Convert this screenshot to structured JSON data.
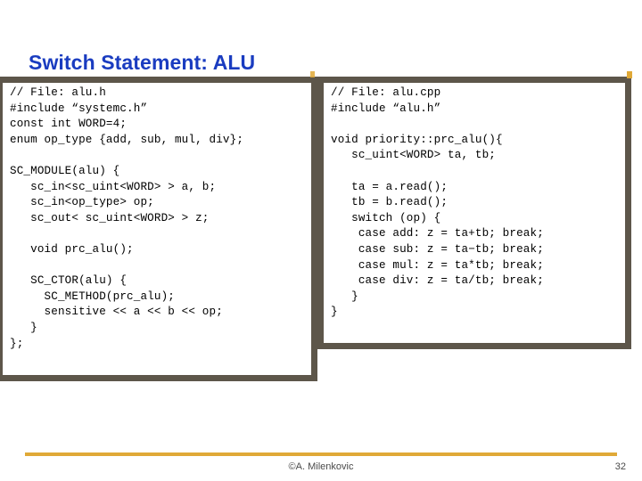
{
  "slide": {
    "title": "Switch Statement: ALU",
    "title_color": "#1a3cc0",
    "accent_color": "#e0a937",
    "box_border_color": "#5d564a"
  },
  "code_boxes": [
    {
      "name": "alu-header",
      "language": "cpp",
      "code": "// File: alu.h\n#include “systemc.h”\nconst int WORD=4;\nenum op_type {add, sub, mul, div};\n\nSC_MODULE(alu) {\n   sc_in<sc_uint<WORD> > a, b;\n   sc_in<op_type> op;\n   sc_out< sc_uint<WORD> > z;\n\n   void prc_alu();\n\n   SC_CTOR(alu) {\n     SC_METHOD(prc_alu);\n     sensitive << a << b << op;\n   }\n};"
    },
    {
      "name": "alu-implementation",
      "language": "cpp",
      "code": "// File: alu.cpp\n#include “alu.h”\n\nvoid priority::prc_alu(){\n   sc_uint<WORD> ta, tb;\n\n   ta = a.read();\n   tb = b.read();\n   switch (op) {\n    case add: z = ta+tb; break;\n    case sub: z = ta−tb; break;\n    case mul: z = ta*tb; break;\n    case div: z = ta/tb; break;\n   }\n}"
    }
  ],
  "footer": {
    "author": "©A. Milenkovic",
    "page_number": "32"
  }
}
